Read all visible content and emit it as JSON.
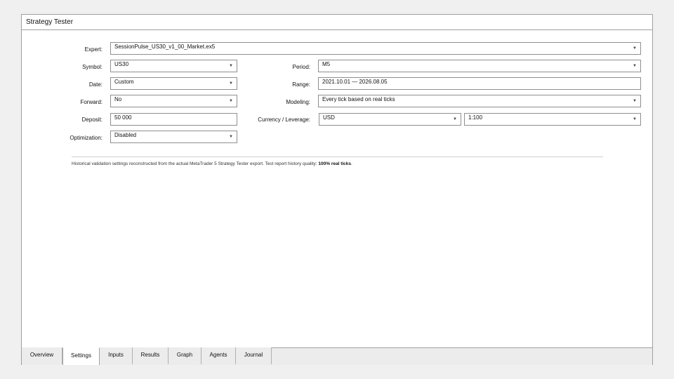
{
  "window": {
    "title": "Strategy Tester"
  },
  "settings": {
    "expert_label": "Expert:",
    "expert_value": "SessionPulse_US30_v1_00_Market.ex5",
    "symbol_label": "Symbol:",
    "symbol_value": "US30",
    "period_label": "Period:",
    "period_value": "M5",
    "date_label": "Date:",
    "date_value": "Custom",
    "range_label": "Range:",
    "range_value": "2021.10.01 — 2026.08.05",
    "forward_label": "Forward:",
    "forward_value": "No",
    "modeling_label": "Modeling:",
    "modeling_value": "Every tick based on real ticks",
    "deposit_label": "Deposit:",
    "deposit_value": "50 000",
    "currency_leverage_label": "Currency / Leverage:",
    "currency_value": "USD",
    "leverage_value": "1:100",
    "optimization_label": "Optimization:",
    "optimization_value": "Disabled"
  },
  "note": {
    "text": "Historical validation settings reconstructed from the actual MetaTrader 5 Strategy Tester export. Test report history quality: ",
    "quality": "100% real ticks",
    "end": "."
  },
  "tabs": [
    {
      "label": "Overview",
      "active": false
    },
    {
      "label": "Settings",
      "active": true
    },
    {
      "label": "Inputs",
      "active": false
    },
    {
      "label": "Results",
      "active": false
    },
    {
      "label": "Graph",
      "active": false
    },
    {
      "label": "Agents",
      "active": false
    },
    {
      "label": "Journal",
      "active": false
    }
  ],
  "icons": {
    "dropdown": "chevron-down-icon"
  }
}
